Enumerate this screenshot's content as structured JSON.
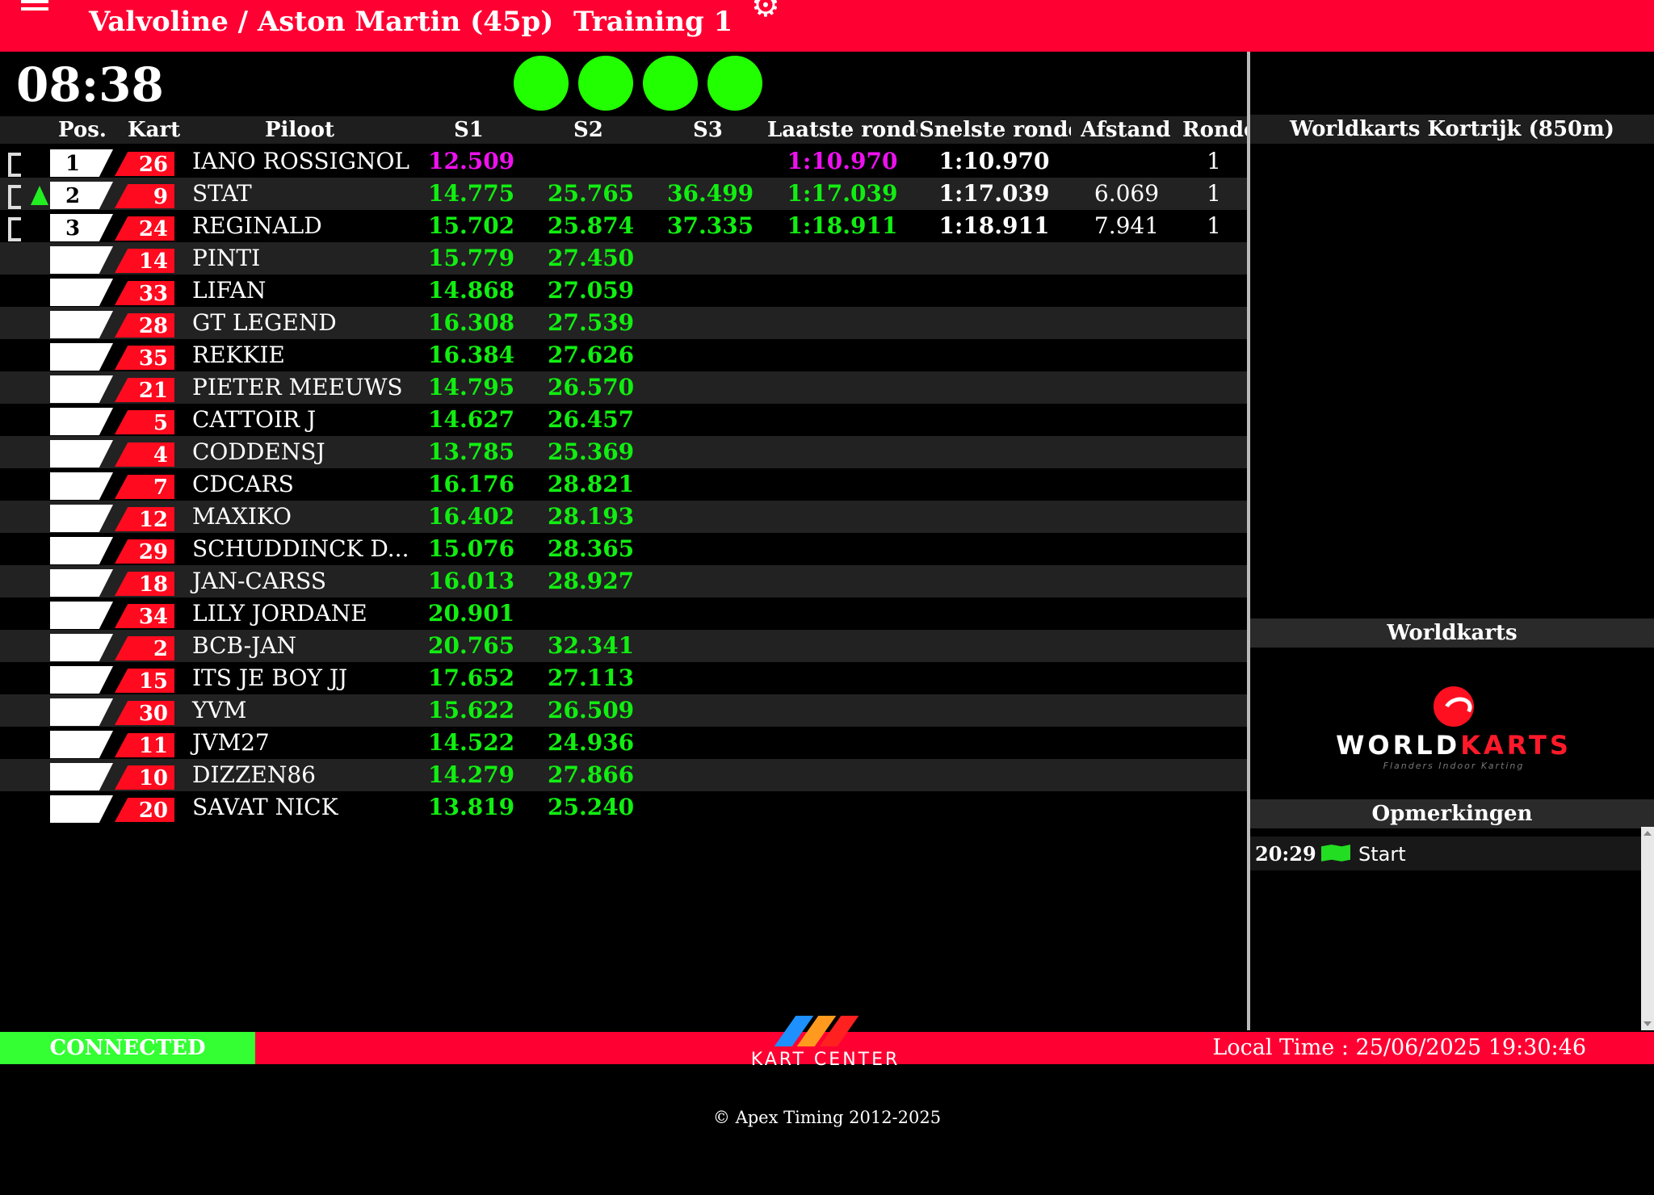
{
  "header": {
    "title": "Valvoline / Aston Martin (45p)",
    "session": "Training 1"
  },
  "clock": "08:38",
  "lights": [
    "green",
    "green",
    "green",
    "green"
  ],
  "columns": {
    "pos": "Pos.",
    "kart": "Kart",
    "pilot": "Piloot",
    "s1": "S1",
    "s2": "S2",
    "s3": "S3",
    "last_lap": "Laatste ronde",
    "best_lap": "Snelste ronde",
    "gap": "Afstand",
    "laps": "Ronde"
  },
  "rows": [
    {
      "pos": "1",
      "kart": "26",
      "pilot": "IANO ROSSIGNOL",
      "s1": "12.509",
      "s2": "",
      "s3": "",
      "last": "1:10.970",
      "best": "1:10.970",
      "gap": "",
      "laps": "1",
      "marker": true,
      "arrow": false,
      "s1_color": "purple",
      "last_color": "purple"
    },
    {
      "pos": "2",
      "kart": "9",
      "pilot": "STAT",
      "s1": "14.775",
      "s2": "25.765",
      "s3": "36.499",
      "last": "1:17.039",
      "best": "1:17.039",
      "gap": "6.069",
      "laps": "1",
      "marker": true,
      "arrow": true,
      "s1_color": "green",
      "last_color": "green"
    },
    {
      "pos": "3",
      "kart": "24",
      "pilot": "REGINALD",
      "s1": "15.702",
      "s2": "25.874",
      "s3": "37.335",
      "last": "1:18.911",
      "best": "1:18.911",
      "gap": "7.941",
      "laps": "1",
      "marker": true,
      "arrow": false,
      "s1_color": "green",
      "last_color": "green"
    },
    {
      "pos": "",
      "kart": "14",
      "pilot": "PINTI",
      "s1": "15.779",
      "s2": "27.450",
      "s3": "",
      "last": "",
      "best": "",
      "gap": "",
      "laps": ""
    },
    {
      "pos": "",
      "kart": "33",
      "pilot": "LIFAN",
      "s1": "14.868",
      "s2": "27.059",
      "s3": "",
      "last": "",
      "best": "",
      "gap": "",
      "laps": ""
    },
    {
      "pos": "",
      "kart": "28",
      "pilot": "GT LEGEND",
      "s1": "16.308",
      "s2": "27.539",
      "s3": "",
      "last": "",
      "best": "",
      "gap": "",
      "laps": ""
    },
    {
      "pos": "",
      "kart": "35",
      "pilot": "REKKIE",
      "s1": "16.384",
      "s2": "27.626",
      "s3": "",
      "last": "",
      "best": "",
      "gap": "",
      "laps": ""
    },
    {
      "pos": "",
      "kart": "21",
      "pilot": "PIETER MEEUWS",
      "s1": "14.795",
      "s2": "26.570",
      "s3": "",
      "last": "",
      "best": "",
      "gap": "",
      "laps": ""
    },
    {
      "pos": "",
      "kart": "5",
      "pilot": "CATTOIR J",
      "s1": "14.627",
      "s2": "26.457",
      "s3": "",
      "last": "",
      "best": "",
      "gap": "",
      "laps": ""
    },
    {
      "pos": "",
      "kart": "4",
      "pilot": "CODDENSJ",
      "s1": "13.785",
      "s2": "25.369",
      "s3": "",
      "last": "",
      "best": "",
      "gap": "",
      "laps": ""
    },
    {
      "pos": "",
      "kart": "7",
      "pilot": "CDCARS",
      "s1": "16.176",
      "s2": "28.821",
      "s3": "",
      "last": "",
      "best": "",
      "gap": "",
      "laps": ""
    },
    {
      "pos": "",
      "kart": "12",
      "pilot": "MAXIKO",
      "s1": "16.402",
      "s2": "28.193",
      "s3": "",
      "last": "",
      "best": "",
      "gap": "",
      "laps": ""
    },
    {
      "pos": "",
      "kart": "29",
      "pilot": "SCHUDDINCK D...",
      "s1": "15.076",
      "s2": "28.365",
      "s3": "",
      "last": "",
      "best": "",
      "gap": "",
      "laps": ""
    },
    {
      "pos": "",
      "kart": "18",
      "pilot": "JAN-CARSS",
      "s1": "16.013",
      "s2": "28.927",
      "s3": "",
      "last": "",
      "best": "",
      "gap": "",
      "laps": ""
    },
    {
      "pos": "",
      "kart": "34",
      "pilot": "LILY JORDANE",
      "s1": "20.901",
      "s2": "",
      "s3": "",
      "last": "",
      "best": "",
      "gap": "",
      "laps": ""
    },
    {
      "pos": "",
      "kart": "2",
      "pilot": "BCB-JAN",
      "s1": "20.765",
      "s2": "32.341",
      "s3": "",
      "last": "",
      "best": "",
      "gap": "",
      "laps": ""
    },
    {
      "pos": "",
      "kart": "15",
      "pilot": "ITS JE BOY JJ",
      "s1": "17.652",
      "s2": "27.113",
      "s3": "",
      "last": "",
      "best": "",
      "gap": "",
      "laps": ""
    },
    {
      "pos": "",
      "kart": "30",
      "pilot": "YVM",
      "s1": "15.622",
      "s2": "26.509",
      "s3": "",
      "last": "",
      "best": "",
      "gap": "",
      "laps": ""
    },
    {
      "pos": "",
      "kart": "11",
      "pilot": "JVM27",
      "s1": "14.522",
      "s2": "24.936",
      "s3": "",
      "last": "",
      "best": "",
      "gap": "",
      "laps": ""
    },
    {
      "pos": "",
      "kart": "10",
      "pilot": "DIZZEN86",
      "s1": "14.279",
      "s2": "27.866",
      "s3": "",
      "last": "",
      "best": "",
      "gap": "",
      "laps": ""
    },
    {
      "pos": "",
      "kart": "20",
      "pilot": "SAVAT NICK",
      "s1": "13.819",
      "s2": "25.240",
      "s3": "",
      "last": "",
      "best": "",
      "gap": "",
      "laps": ""
    }
  ],
  "panel": {
    "track_title": "Worldkarts Kortrijk (850m)",
    "sponsor_title": "Worldkarts",
    "logo_text_white": "WORLD",
    "logo_text_red": "KARTS",
    "logo_sub": "Flanders Indoor Karting",
    "notes_title": "Opmerkingen",
    "notes": [
      {
        "time": "20:29",
        "icon": "green-flag-icon",
        "text": "Start"
      }
    ]
  },
  "footer": {
    "status": "CONNECTED",
    "local_time": "Local Time : 25/06/2025 19:30:46",
    "brand": "KART CENTER",
    "copyright": "© Apex Timing 2012-2025"
  },
  "colors": {
    "brand_red": "#ff0033",
    "sector_green": "#11ee11",
    "best_purple": "#ee11ee",
    "connected_green": "#33ff33"
  }
}
